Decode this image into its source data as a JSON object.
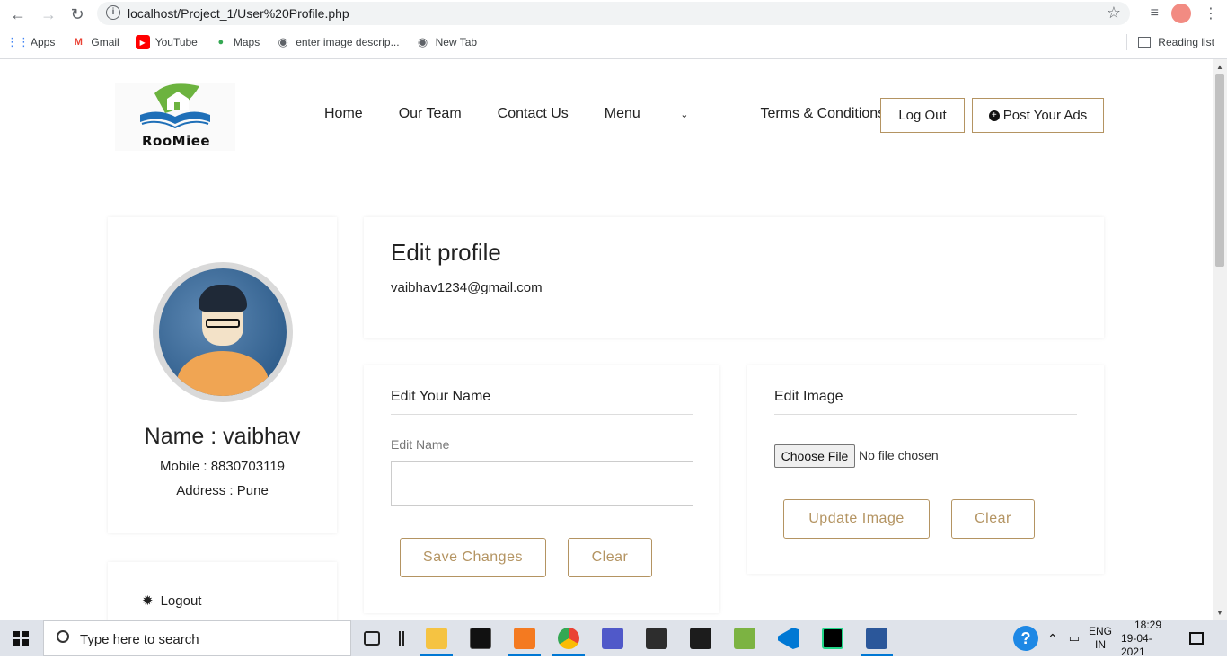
{
  "browser": {
    "url": "localhost/Project_1/User%20Profile.php",
    "bookmarks": [
      "Apps",
      "Gmail",
      "YouTube",
      "Maps",
      "enter image descrip...",
      "New Tab"
    ],
    "reading_list": "Reading list"
  },
  "site": {
    "logo_text": "RooMiee",
    "nav": [
      "Home",
      "Our Team",
      "Contact Us",
      "Menu",
      "Terms & Conditions"
    ],
    "logout_btn": "Log Out",
    "post_ads_btn": "Post Your Ads"
  },
  "profile": {
    "name": "Name : vaibhav",
    "mobile": "Mobile : 8830703119",
    "address": "Address : Pune",
    "logout_link": "Logout"
  },
  "edit_profile": {
    "title": "Edit profile",
    "email": "vaibhav1234@gmail.com"
  },
  "edit_name": {
    "title": "Edit Your Name",
    "label": "Edit Name",
    "save_btn": "Save Changes",
    "clear_btn": "Clear"
  },
  "edit_image": {
    "title": "Edit Image",
    "choose_btn": "Choose File",
    "no_file": "No file chosen",
    "update_btn": "Update Image",
    "clear_btn": "Clear"
  },
  "taskbar": {
    "search_placeholder": "Type here to search",
    "lang": "ENG",
    "region": "IN",
    "time": "18:29",
    "date": "19-04-2021"
  },
  "colors": {
    "accent": "#b49462",
    "taskbar_bg": "#dfe3ea"
  }
}
